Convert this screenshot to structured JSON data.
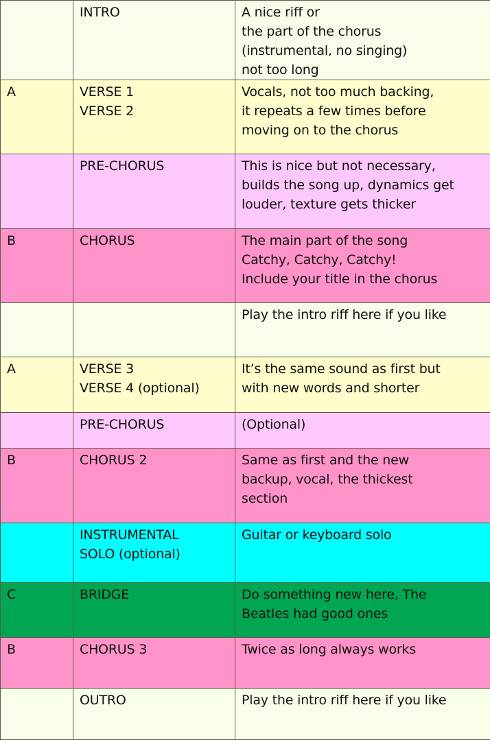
{
  "colors": {
    "intro_outro": "#f7fee9",
    "verse": "#fffdcc",
    "pre_chorus": "#ffc8fd",
    "chorus": "#ff93c9",
    "instrumental": "#00ffff",
    "bridge": "#00a651",
    "border": "#5a5a4a"
  },
  "rows": [
    {
      "letter": "",
      "section": "INTRO",
      "description": "A nice riff or\nthe part of the chorus\n(instrumental, no singing)\nnot too long",
      "color": "#f7fee9"
    },
    {
      "letter": "A",
      "section": "VERSE 1\nVERSE 2",
      "description": "Vocals, not too much backing,\nit repeats a few times before\nmoving on to the chorus",
      "color": "#fffdcc"
    },
    {
      "letter": "",
      "section": "PRE-CHORUS",
      "description": "This is nice but not necessary,\nbuilds the song up, dynamics get\nlouder, texture gets thicker",
      "color": "#ffc8fd"
    },
    {
      "letter": "B",
      "section": "CHORUS",
      "description": "The main part of the song\nCatchy, Catchy, Catchy!\nInclude your title in the chorus",
      "color": "#ff93c9"
    },
    {
      "letter": "",
      "section": "",
      "description": "Play the intro riff here if you like",
      "color": "#f7fee9"
    },
    {
      "letter": "A",
      "section": "VERSE 3\nVERSE 4 (optional)",
      "description": "It’s the same sound as first but\nwith new words and shorter",
      "color": "#fffdcc"
    },
    {
      "letter": "",
      "section": "PRE-CHORUS",
      "description": "(Optional)",
      "color": "#ffc8fd"
    },
    {
      "letter": "B",
      "section": "CHORUS 2",
      "description": "Same as first and the new\nbackup, vocal, the thickest\nsection",
      "color": "#ff93c9"
    },
    {
      "letter": "",
      "section": "INSTRUMENTAL\nSOLO (optional)",
      "description": "Guitar or keyboard solo",
      "color": "#00ffff"
    },
    {
      "letter": "C",
      "section": "BRIDGE",
      "description": "Do something new here, The\nBeatles had good ones",
      "color": "#00a651"
    },
    {
      "letter": "B",
      "section": "CHORUS 3",
      "description": "Twice as long always works",
      "color": "#ff93c9"
    },
    {
      "letter": "",
      "section": "OUTRO",
      "description": "Play the intro riff here if you like",
      "color": "#f7fee9"
    }
  ]
}
